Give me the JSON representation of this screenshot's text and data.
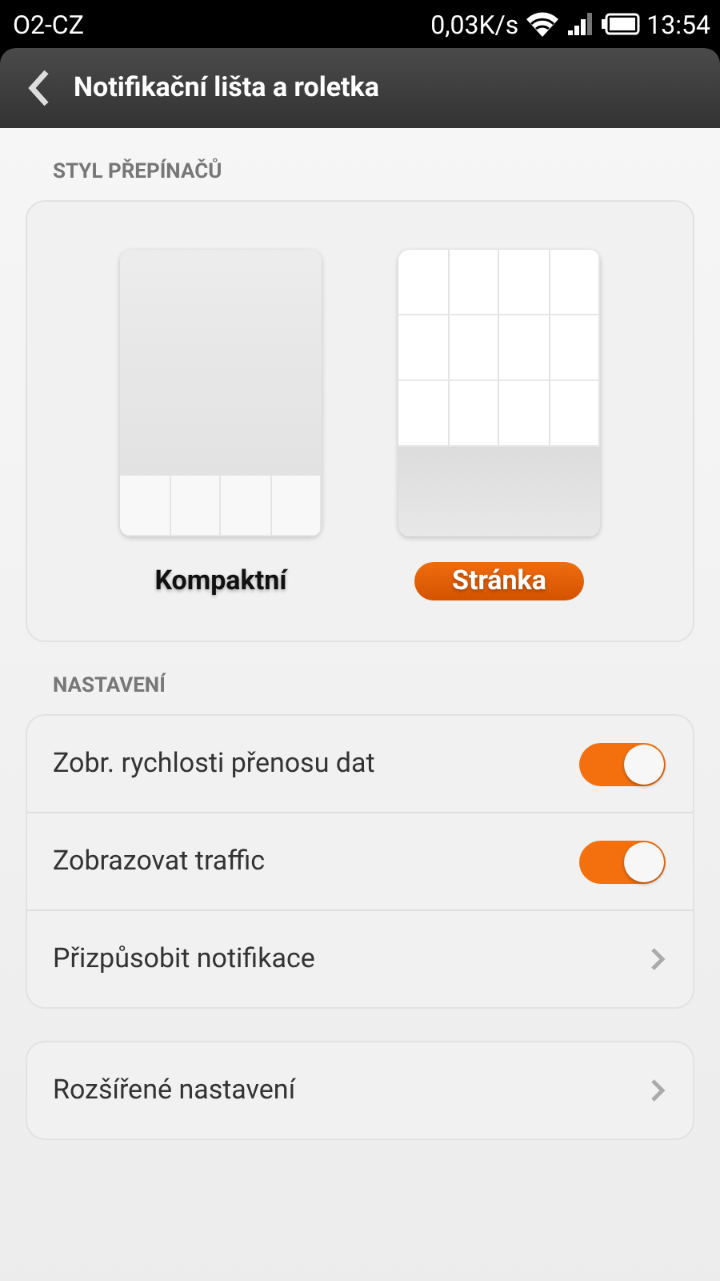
{
  "status_bar": {
    "carrier": "O2-CZ",
    "speed": "0,03K/s",
    "time": "13:54"
  },
  "header": {
    "title": "Notifikační lišta a roletka"
  },
  "switch_style": {
    "heading": "STYL PŘEPÍNAČŮ",
    "options": [
      {
        "label": "Kompaktní",
        "kind": "compact",
        "selected": false
      },
      {
        "label": "Stránka",
        "kind": "page",
        "selected": true
      }
    ]
  },
  "settings": {
    "heading": "NASTAVENÍ",
    "groups": [
      {
        "items": [
          {
            "label": "Zobr. rychlosti přenosu dat",
            "kind": "toggle",
            "on": true
          },
          {
            "label": "Zobrazovat traffic",
            "kind": "toggle",
            "on": true
          },
          {
            "label": "Přizpůsobit notifikace",
            "kind": "link"
          }
        ]
      },
      {
        "items": [
          {
            "label": "Rozšířené nastavení",
            "kind": "link"
          }
        ]
      }
    ]
  }
}
